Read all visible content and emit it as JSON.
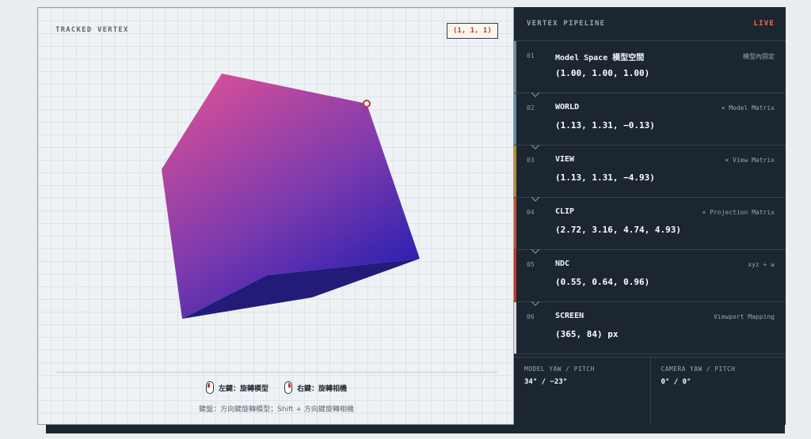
{
  "viewport": {
    "title": "TRACKED VERTEX",
    "badge": "(1, 1, 1)",
    "hints": {
      "left_click": "左鍵：旋轉模型",
      "right_click": "右鍵：旋轉相機",
      "keyboard": "鍵盤：方向鍵旋轉模型；Shift + 方向鍵旋轉相機"
    }
  },
  "panel": {
    "title": "VERTEX PIPELINE",
    "live": "LIVE",
    "stages": [
      {
        "num": "01",
        "name": "Model Space 模型空間",
        "op": "模型內固定",
        "value": "(1.00, 1.00, 1.00)",
        "color": "#7a8590"
      },
      {
        "num": "02",
        "name": "WORLD",
        "op": "× Model Matrix",
        "value": "(1.13, 1.31, −0.13)",
        "color": "#5f8aa6"
      },
      {
        "num": "03",
        "name": "VIEW",
        "op": "× View Matrix",
        "value": "(1.13, 1.31, −4.93)",
        "color": "#b88a3a"
      },
      {
        "num": "04",
        "name": "CLIP",
        "op": "× Projection Matrix",
        "value": "(2.72, 3.16, 4.74, 4.93)",
        "color": "#b8583a"
      },
      {
        "num": "05",
        "name": "NDC",
        "op": "xyz ÷ w",
        "value": "(0.55, 0.64, 0.96)",
        "color": "#c0392b"
      },
      {
        "num": "06",
        "name": "SCREEN",
        "op": "Viewport Mapping",
        "value": "(365, 84) px",
        "color": "#d8dde2"
      }
    ],
    "footer": {
      "model_label": "MODEL YAW / PITCH",
      "model_value": "34° / −23°",
      "camera_label": "CAMERA YAW / PITCH",
      "camera_value": "0° / 0°"
    }
  },
  "colors": {
    "accent": "#c0392b",
    "panel_bg": "#1c2630",
    "cube_top": "#d24e9a",
    "cube_bottom": "#2a1fb0"
  }
}
